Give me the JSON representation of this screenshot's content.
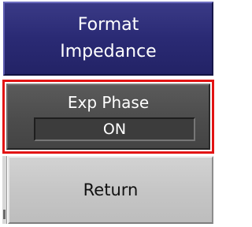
{
  "softkeys": {
    "format_impedance": {
      "line1": "Format",
      "line2": "Impedance"
    },
    "exp_phase": {
      "label": "Exp Phase",
      "value": "ON",
      "selected": true
    },
    "return": {
      "label": "Return"
    }
  },
  "colors": {
    "format_button": "#2a2a74",
    "exp_phase_button": "#4c4c4c",
    "selection_border": "#e21414",
    "return_button": "#c6c6c6"
  }
}
